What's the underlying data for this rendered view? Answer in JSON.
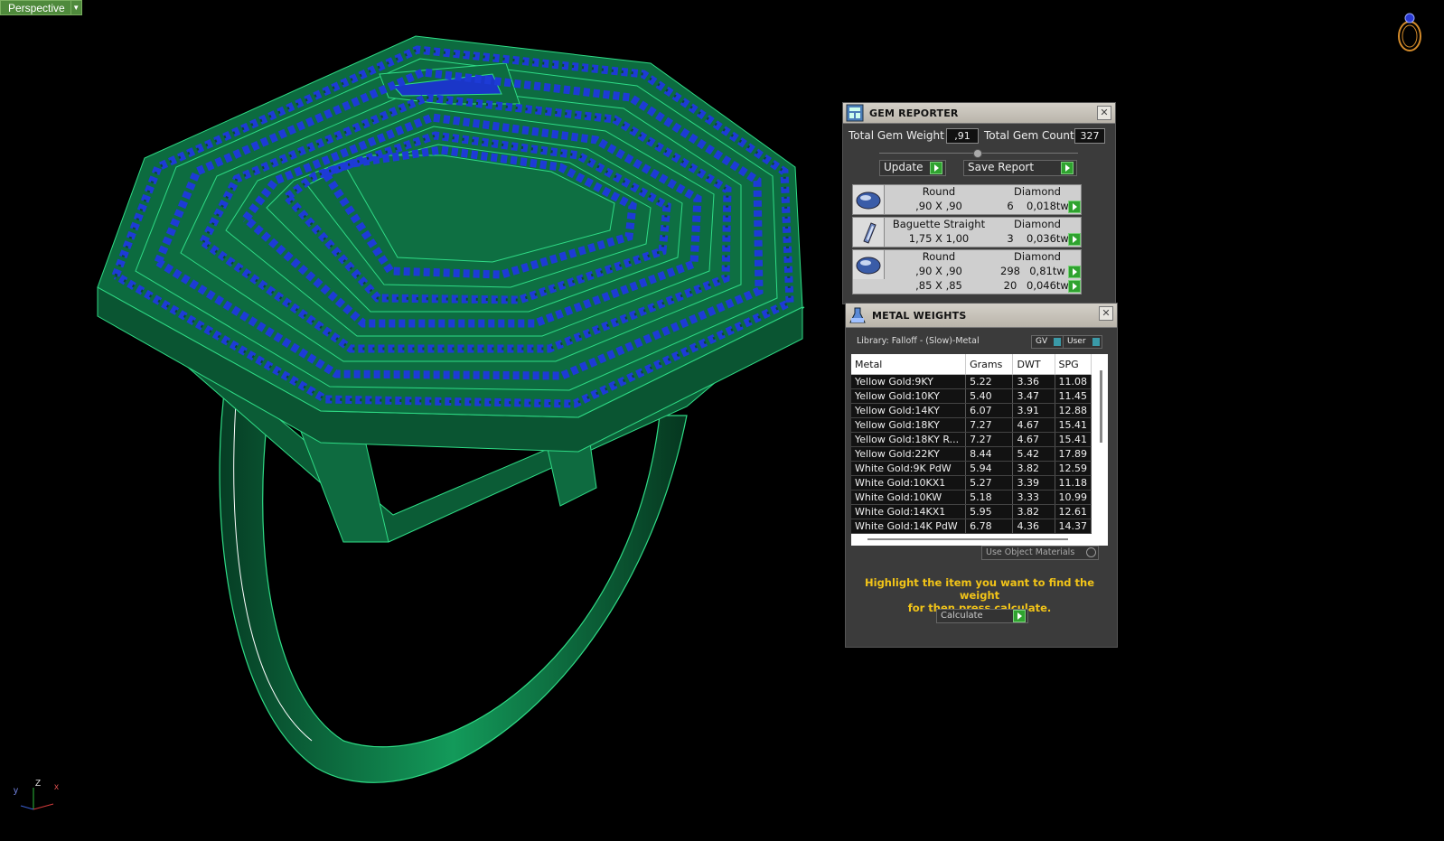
{
  "viewport": {
    "label": "Perspective"
  },
  "axis": {
    "z": "Z",
    "y": "y",
    "x": "x"
  },
  "icons": {
    "corner": "ring-outline-icon",
    "gem_reporter": "gem-reporter-icon",
    "metal_weights": "flask-icon"
  },
  "colors": {
    "metal": "#0f7a48",
    "gem": "#1d3bd6",
    "panel_bg": "#3b3b3b",
    "hint": "#f2c418",
    "go_button": "#2fa32f"
  },
  "gem_reporter": {
    "title": "GEM REPORTER",
    "total_weight_label": "Total Gem Weight",
    "total_weight_value": ",91",
    "total_count_label": "Total Gem Count",
    "total_count_value": "327",
    "update_label": "Update",
    "save_label": "Save Report",
    "gems": [
      {
        "shape": "Round",
        "material": "Diamond",
        "rows": [
          {
            "size": ",90 X ,90",
            "count": "6",
            "weight": "0,018tw"
          }
        ]
      },
      {
        "shape": "Baguette Straight",
        "material": "Diamond",
        "rows": [
          {
            "size": "1,75 X 1,00",
            "count": "3",
            "weight": "0,036tw"
          }
        ]
      },
      {
        "shape": "Round",
        "material": "Diamond",
        "rows": [
          {
            "size": ",90 X ,90",
            "count": "298",
            "weight": "0,81tw"
          },
          {
            "size": ",85 X ,85",
            "count": "20",
            "weight": "0,046tw"
          }
        ]
      }
    ]
  },
  "metal_weights": {
    "title": "METAL WEIGHTS",
    "library": "Library: Falloff - (Slow)-Metal",
    "toggle_gv": "GV",
    "toggle_user": "User",
    "columns": [
      "Metal",
      "Grams",
      "DWT",
      "SPG"
    ],
    "rows": [
      [
        "Yellow Gold:9KY",
        "5.22",
        "3.36",
        "11.08"
      ],
      [
        "Yellow Gold:10KY",
        "5.40",
        "3.47",
        "11.45"
      ],
      [
        "Yellow Gold:14KY",
        "6.07",
        "3.91",
        "12.88"
      ],
      [
        "Yellow Gold:18KY",
        "7.27",
        "4.67",
        "15.41"
      ],
      [
        "Yellow Gold:18KY R...",
        "7.27",
        "4.67",
        "15.41"
      ],
      [
        "Yellow Gold:22KY",
        "8.44",
        "5.42",
        "17.89"
      ],
      [
        "White Gold:9K PdW",
        "5.94",
        "3.82",
        "12.59"
      ],
      [
        "White Gold:10KX1",
        "5.27",
        "3.39",
        "11.18"
      ],
      [
        "White Gold:10KW",
        "5.18",
        "3.33",
        "10.99"
      ],
      [
        "White Gold:14KX1",
        "5.95",
        "3.82",
        "12.61"
      ],
      [
        "White Gold:14K PdW",
        "6.78",
        "4.36",
        "14.37"
      ]
    ],
    "use_object_materials": "Use Object Materials",
    "hint_line1": "Highlight the item you want to find the weight",
    "hint_line2": "for then press calculate.",
    "calculate_label": "Calculate"
  }
}
